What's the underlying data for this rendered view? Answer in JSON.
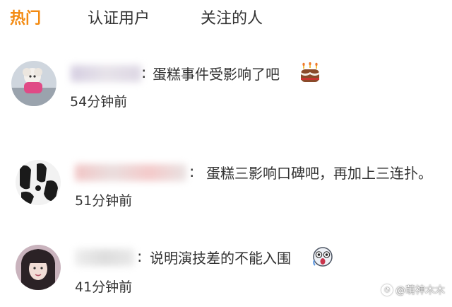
{
  "tabs": [
    {
      "label": "热门",
      "active": true
    },
    {
      "label": "认证用户",
      "active": false
    },
    {
      "label": "关注的人",
      "active": false
    }
  ],
  "accent_color": "#f38a11",
  "comments": [
    {
      "text": "蛋糕事件受影响了吧",
      "time": "54分钟前",
      "emoji": "cake-emoji",
      "username_redacted": true
    },
    {
      "text": "蛋糕三影响口碑吧，再加上三连扑。",
      "time": "51分钟前",
      "emoji": null,
      "username_redacted": true
    },
    {
      "text": "说明演技差的不能入围",
      "time": "41分钟前",
      "emoji": "shocked-face-emoji",
      "username_redacted": true
    }
  ],
  "watermark": {
    "text": "@萌神木木"
  }
}
